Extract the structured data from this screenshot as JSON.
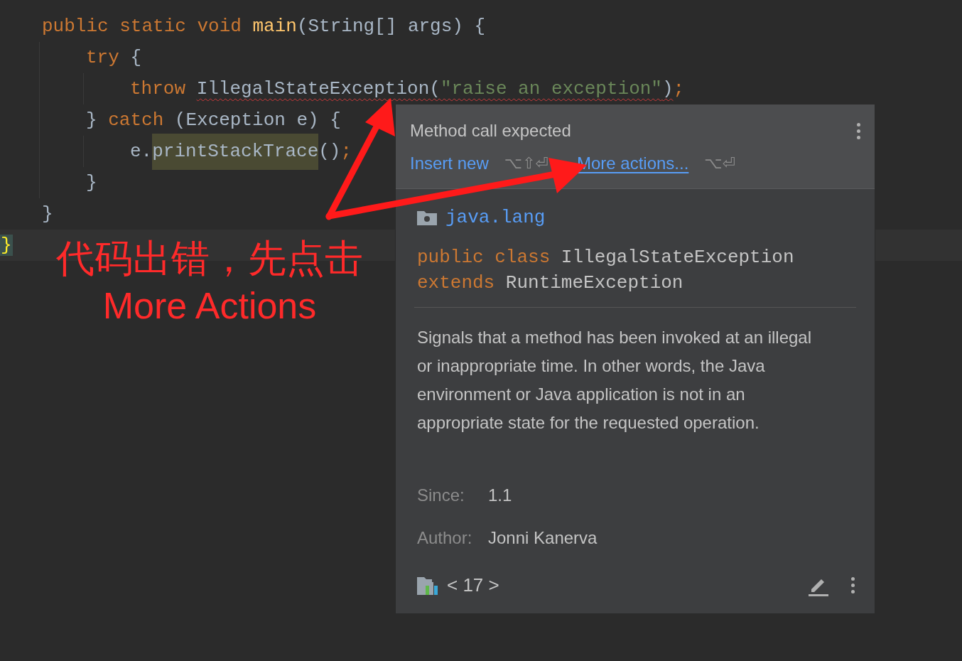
{
  "editor": {
    "lines": [
      {
        "tokens": [
          {
            "kind": "keyword",
            "text": "public ",
            "error": false,
            "highlighted": false
          },
          {
            "kind": "keyword",
            "text": "static ",
            "error": false,
            "highlighted": false
          },
          {
            "kind": "keyword",
            "text": "void ",
            "error": false,
            "highlighted": false
          },
          {
            "kind": "function",
            "text": "main",
            "error": false,
            "highlighted": false
          },
          {
            "kind": "plain",
            "text": "(String[] args) {",
            "error": false,
            "highlighted": false
          }
        ],
        "children": [
          {
            "tokens": [
              {
                "kind": "keyword",
                "text": "try ",
                "error": false,
                "highlighted": false
              },
              {
                "kind": "plain",
                "text": "{",
                "error": false,
                "highlighted": false
              }
            ],
            "children": [
              {
                "tokens": [
                  {
                    "kind": "keyword",
                    "text": "throw ",
                    "error": false,
                    "highlighted": false
                  },
                  {
                    "kind": "plain",
                    "text": "IllegalStateException(",
                    "error": true,
                    "highlighted": false
                  },
                  {
                    "kind": "string",
                    "text": "\"raise an exception\"",
                    "error": true,
                    "highlighted": false
                  },
                  {
                    "kind": "plain",
                    "text": ")",
                    "error": true,
                    "highlighted": false
                  },
                  {
                    "kind": "keyword",
                    "text": ";",
                    "error": false,
                    "highlighted": false
                  }
                ]
              }
            ]
          },
          {
            "tokens": [
              {
                "kind": "plain",
                "text": "} ",
                "error": false,
                "highlighted": false
              },
              {
                "kind": "keyword",
                "text": "catch ",
                "error": false,
                "highlighted": false
              },
              {
                "kind": "plain",
                "text": "(Exception e) {",
                "error": false,
                "highlighted": false
              }
            ],
            "children": [
              {
                "tokens": [
                  {
                    "kind": "plain",
                    "text": "e.",
                    "error": false,
                    "highlighted": false
                  },
                  {
                    "kind": "plain",
                    "text": "printStackTrace",
                    "error": false,
                    "highlighted": true
                  },
                  {
                    "kind": "plain",
                    "text": "()",
                    "error": false,
                    "highlighted": false
                  },
                  {
                    "kind": "keyword",
                    "text": ";",
                    "error": false,
                    "highlighted": false
                  }
                ]
              }
            ]
          },
          {
            "tokens": [
              {
                "kind": "plain",
                "text": "}",
                "error": false,
                "highlighted": false
              }
            ]
          }
        ]
      },
      {
        "tokens": [
          {
            "kind": "plain",
            "text": "}",
            "error": false,
            "highlighted": false
          }
        ]
      }
    ],
    "caret_line": {
      "gutter_mark": "}"
    }
  },
  "annotation": {
    "lines": [
      "代码出错，先点击",
      "More Actions"
    ]
  },
  "popup": {
    "title": "Method call expected",
    "actions": [
      {
        "label": "Insert new",
        "shortcut": "⌥⇧⏎"
      },
      {
        "label": "More actions...",
        "shortcut": "⌥⏎"
      }
    ],
    "package": "java.lang",
    "declaration": [
      [
        {
          "kind": "keyword",
          "text": "public class "
        },
        {
          "kind": "plain",
          "text": "IllegalStateException"
        }
      ],
      [
        {
          "kind": "keyword",
          "text": "extends "
        },
        {
          "kind": "plain",
          "text": "RuntimeException"
        }
      ]
    ],
    "description": "Signals that a method has been invoked at an illegal or inappropriate time. In other words, the Java environment or Java application is not in an appropriate state for the requested operation.",
    "fields": [
      {
        "label": "Since:",
        "value": "1.1"
      },
      {
        "label": "Author:",
        "value": "Jonni Kanerva"
      }
    ],
    "footer": {
      "version": "< 17 >"
    }
  }
}
